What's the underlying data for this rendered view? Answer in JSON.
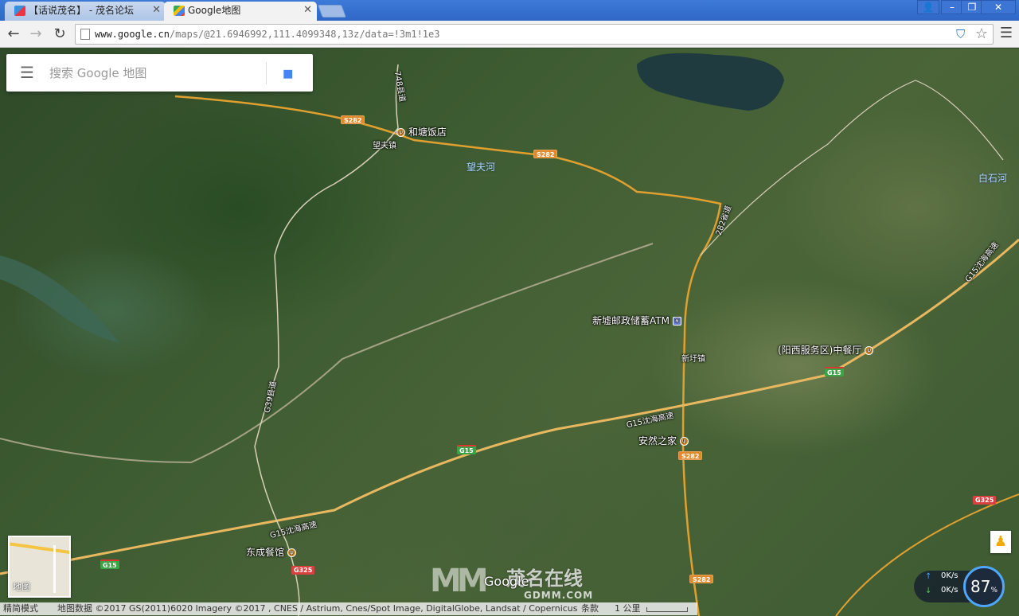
{
  "browser": {
    "tabs": [
      {
        "title": "【话说茂名】 - 茂名论坛",
        "active": false
      },
      {
        "title": "Google地图",
        "active": true
      }
    ],
    "address": {
      "host": "www.google.cn",
      "path": "/maps/@21.6946992,111.4099348,13z/data=!3m1!1e3"
    }
  },
  "search": {
    "placeholder": "搜索 Google 地图"
  },
  "map_labels": {
    "roads": {
      "s282_a": "S282",
      "s282_b": "S282",
      "s282_c": "S282",
      "s282_d": "S282",
      "x282": "282省道",
      "g39": "G39县道",
      "x748": "748县道",
      "g15_a": "G15",
      "g15_b": "G15",
      "g15_c": "G15",
      "g15_d": "G15",
      "g15_name_a": "G15沈海高速",
      "g15_name_b": "G15沈海高速",
      "g15_name_c": "G15沈海高速",
      "g325_a": "G325",
      "g325_b": "G325"
    },
    "places": {
      "hetang": "和塘饭店",
      "wangfu": "望夫镇",
      "wangfu_river": "望夫河",
      "baishi_river": "白石河",
      "xinxu_atm": "新墟邮政储蓄ATM",
      "xinxu_town": "新圩镇",
      "yangxi_service": "(阳西服务区)中餐厅",
      "anran": "安然之家",
      "dongcheng": "东成餐馆"
    }
  },
  "minimap_label": "地图",
  "google_logo": "Google",
  "watermark": {
    "cn": "茂名在线",
    "en": "GDMM.COM"
  },
  "net_monitor": {
    "up": "0K/s",
    "down": "0K/s",
    "percent": "87",
    "unit": "%"
  },
  "footer": {
    "mode": "精简模式",
    "attribution": "地图数据 ©2017 GS(2011)6020 Imagery ©2017 , CNES / Astrium, Cnes/Spot Image, DigitalGlobe, Landsat / Copernicus",
    "terms": "条款",
    "scale": "1 公里"
  }
}
